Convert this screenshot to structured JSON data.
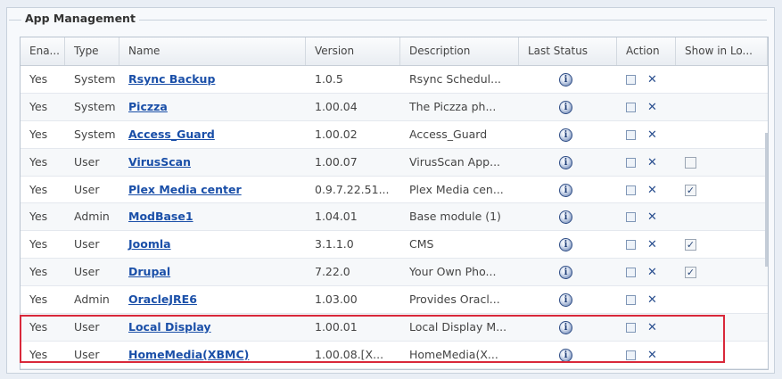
{
  "panel": {
    "title": "App Management"
  },
  "columns": [
    "Ena...",
    "Type",
    "Name",
    "Version",
    "Description",
    "Last Status",
    "Action",
    "Show in Lo..."
  ],
  "rows": [
    {
      "enabled": "Yes",
      "type": "System",
      "name": "Rsync Backup",
      "version": "1.0.5",
      "description": "Rsync Schedul...",
      "show_in_login": null
    },
    {
      "enabled": "Yes",
      "type": "System",
      "name": "Piczza",
      "version": "1.00.04",
      "description": "The Piczza ph...",
      "show_in_login": null
    },
    {
      "enabled": "Yes",
      "type": "System",
      "name": "Access_Guard",
      "version": "1.00.02",
      "description": "Access_Guard",
      "show_in_login": null
    },
    {
      "enabled": "Yes",
      "type": "User",
      "name": "VirusScan",
      "version": "1.00.07",
      "description": "VirusScan App...",
      "show_in_login": false
    },
    {
      "enabled": "Yes",
      "type": "User",
      "name": "Plex Media center",
      "version": "0.9.7.22.51...",
      "description": "Plex Media cen...",
      "show_in_login": true
    },
    {
      "enabled": "Yes",
      "type": "Admin",
      "name": "ModBase1",
      "version": "1.04.01",
      "description": "Base module (1)",
      "show_in_login": null
    },
    {
      "enabled": "Yes",
      "type": "User",
      "name": "Joomla",
      "version": "3.1.1.0",
      "description": "CMS",
      "show_in_login": true
    },
    {
      "enabled": "Yes",
      "type": "User",
      "name": "Drupal",
      "version": "7.22.0",
      "description": "Your Own Pho...",
      "show_in_login": true
    },
    {
      "enabled": "Yes",
      "type": "Admin",
      "name": "OracleJRE6",
      "version": "1.03.00",
      "description": "Provides Oracl...",
      "show_in_login": null
    },
    {
      "enabled": "Yes",
      "type": "User",
      "name": "Local Display",
      "version": "1.00.01",
      "description": "Local Display M...",
      "show_in_login": null
    },
    {
      "enabled": "Yes",
      "type": "User",
      "name": "HomeMedia(XBMC)",
      "version": "1.00.08.[X...",
      "description": "HomeMedia(X...",
      "show_in_login": null
    }
  ],
  "icons": {
    "status": "info-icon",
    "action_edit": "checkbox-icon",
    "action_delete": "close-icon"
  },
  "colors": {
    "link": "#1a4fa8",
    "highlight": "#d9283a"
  }
}
